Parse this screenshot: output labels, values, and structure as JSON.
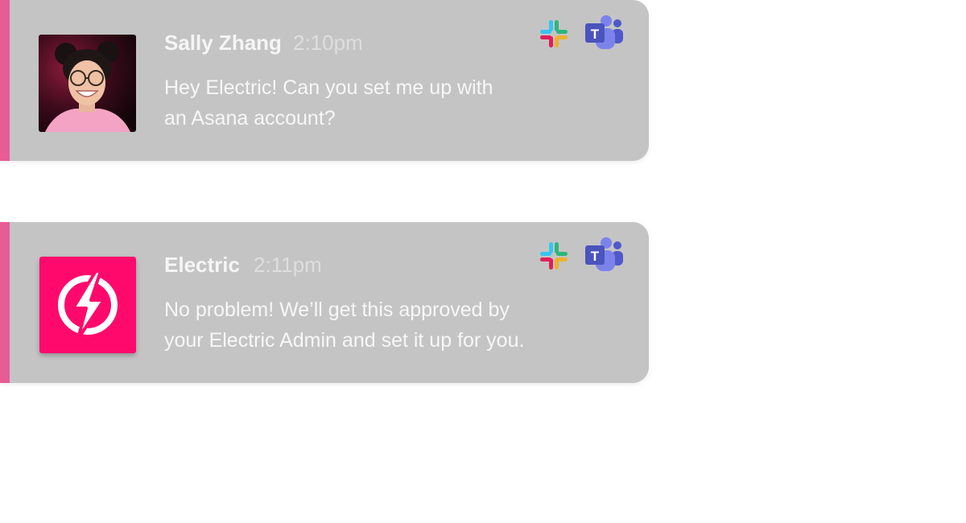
{
  "messages": [
    {
      "sender": "Sally Zhang",
      "time": "2:10pm",
      "text_line1": "Hey Electric! Can you set me up with",
      "text_line2": "an Asana account?",
      "avatar": "user-photo",
      "platforms": [
        "slack-icon",
        "teams-icon"
      ]
    },
    {
      "sender": "Electric",
      "time": "2:11pm",
      "text_line1": "No problem!  We’ll get this approved by",
      "text_line2": "your Electric Admin and set it up for you.",
      "avatar": "electric-logo-icon",
      "platforms": [
        "slack-icon",
        "teams-icon"
      ]
    }
  ],
  "colors": {
    "accent": "#e85b95",
    "card_bg": "#c4c4c4",
    "electric_brand": "#ff0a6c",
    "teams_purple": "#4b53bc",
    "slack_blue": "#36c5f0",
    "slack_green": "#2eb67d",
    "slack_red": "#e01e5a",
    "slack_yellow": "#ecb22e"
  }
}
